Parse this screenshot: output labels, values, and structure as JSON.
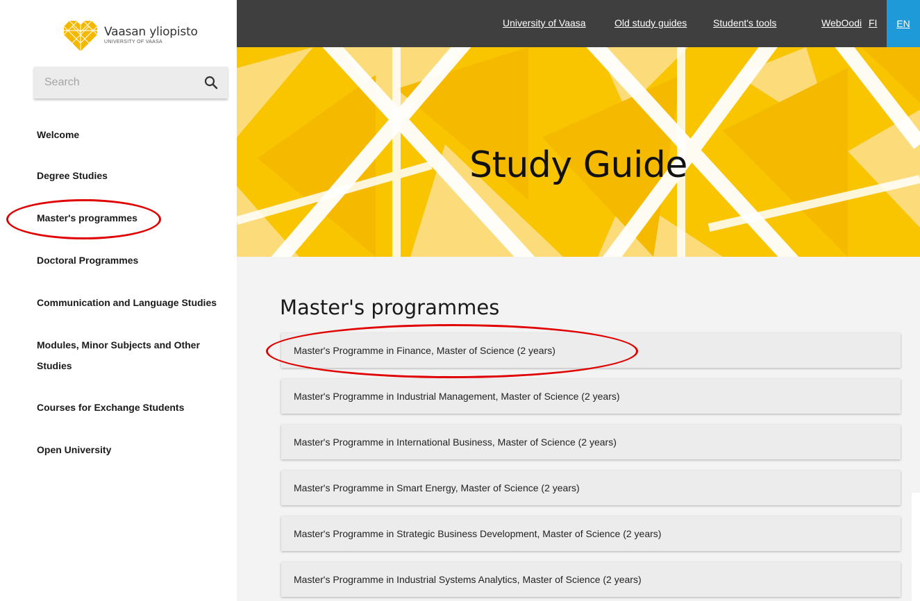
{
  "logo": {
    "name": "Vaasan yliopisto",
    "subtitle": "UNIVERSITY OF VAASA"
  },
  "search": {
    "placeholder": "Search",
    "icon": "search-icon"
  },
  "sidebar": {
    "items": [
      {
        "label": "Welcome"
      },
      {
        "label": "Degree Studies"
      },
      {
        "label": "Master's programmes"
      },
      {
        "label": "Doctoral Programmes"
      },
      {
        "label": "Communication and Language Studies"
      },
      {
        "label": "Modules, Minor Subjects and Other Studies"
      },
      {
        "label": "Courses for Exchange Students"
      },
      {
        "label": "Open University"
      }
    ]
  },
  "topnav": {
    "links": [
      {
        "label": "University of Vaasa"
      },
      {
        "label": "Old study guides"
      },
      {
        "label": "Student's tools"
      },
      {
        "label": "WebOodi"
      },
      {
        "label": "FI"
      }
    ],
    "active_lang": "EN"
  },
  "banner": {
    "title": "Study Guide"
  },
  "main": {
    "title": "Master's programmes",
    "programmes": [
      {
        "label": "Master's Programme in Finance, Master of Science (2 years)"
      },
      {
        "label": "Master's Programme in Industrial Management,  Master of Science (2 years)"
      },
      {
        "label": "Master's Programme in International Business, Master of Science (2 years)"
      },
      {
        "label": "Master's Programme in Smart Energy, Master of Science (2 years)"
      },
      {
        "label": "Master's Programme in Strategic Business Development, Master of Science (2 years)"
      },
      {
        "label": "Master's Programme in Industrial Systems Analytics, Master of Science (2 years)"
      }
    ]
  },
  "colors": {
    "topbar": "#3f3f3f",
    "lang_active": "#1e9ad9",
    "banner_yellow": "#f9c400",
    "annotation": "#e00000"
  }
}
